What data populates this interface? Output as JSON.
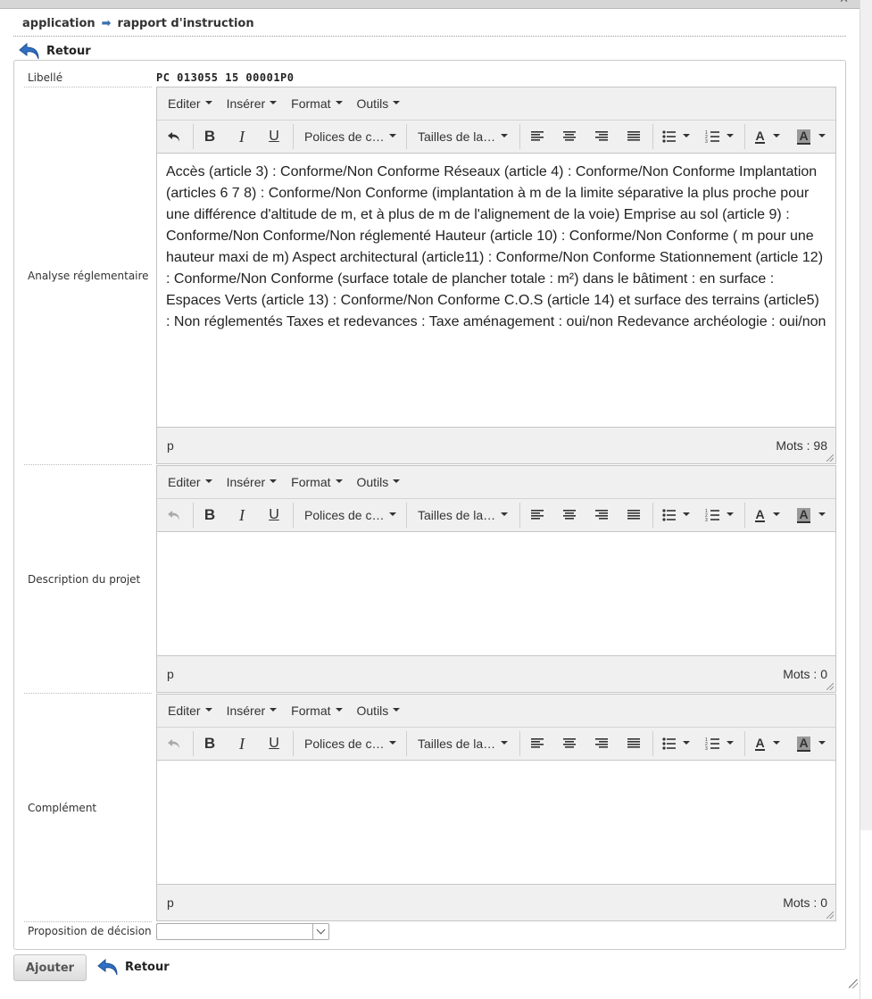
{
  "breadcrumb": {
    "root": "application",
    "current": "rapport d'instruction"
  },
  "back_label": "Retour",
  "fields": {
    "libelle_label": "Libellé",
    "libelle_value": "PC 013055 15 00001P0",
    "analyse_label": "Analyse réglementaire",
    "description_label": "Description du projet",
    "complement_label": "Complément",
    "proposition_label": "Proposition de décision",
    "proposition_value": ""
  },
  "editor": {
    "menus": [
      "Editer",
      "Insérer",
      "Format",
      "Outils"
    ],
    "font_family_label": "Polices de c…",
    "font_size_label": "Tailles de la…",
    "icons": [
      "undo-icon",
      "bold-icon",
      "italic-icon",
      "underline-icon",
      "align-left-icon",
      "align-center-icon",
      "align-right-icon",
      "align-justify-icon",
      "bullet-list-icon",
      "numbered-list-icon",
      "text-color-icon",
      "background-color-icon"
    ],
    "path_label": "p"
  },
  "editors": [
    {
      "content": "Accès (article 3) : Conforme/Non Conforme Réseaux (article 4) : Conforme/Non Conforme Implantation (articles 6 7 8) : Conforme/Non Conforme (implantation à m de la limite séparative la plus proche pour une différence d'altitude de m, et à plus de m de l'alignement de la voie) Emprise au sol (article 9) : Conforme/Non Conforme/Non réglementé Hauteur (article 10) : Conforme/Non Conforme ( m pour une hauteur maxi de m) Aspect architectural (article11) : Conforme/Non Conforme Stationnement (article 12) : Conforme/Non Conforme (surface totale de plancher totale : m²) dans le bâtiment : en surface : Espaces Verts (article 13) : Conforme/Non Conforme C.O.S (article 14) et surface des terrains (article5) : Non réglementés Taxes et redevances : Taxe aménagement : oui/non Redevance archéologie : oui/non",
      "word_count": "Mots : 98"
    },
    {
      "content": "",
      "word_count": "Mots : 0"
    },
    {
      "content": "",
      "word_count": "Mots : 0"
    }
  ],
  "actions": {
    "submit_label": "Ajouter",
    "back_label": "Retour"
  },
  "colors": {
    "accent_blue": "#3a6fb0",
    "toolbar_bg": "#f0f0f0"
  }
}
